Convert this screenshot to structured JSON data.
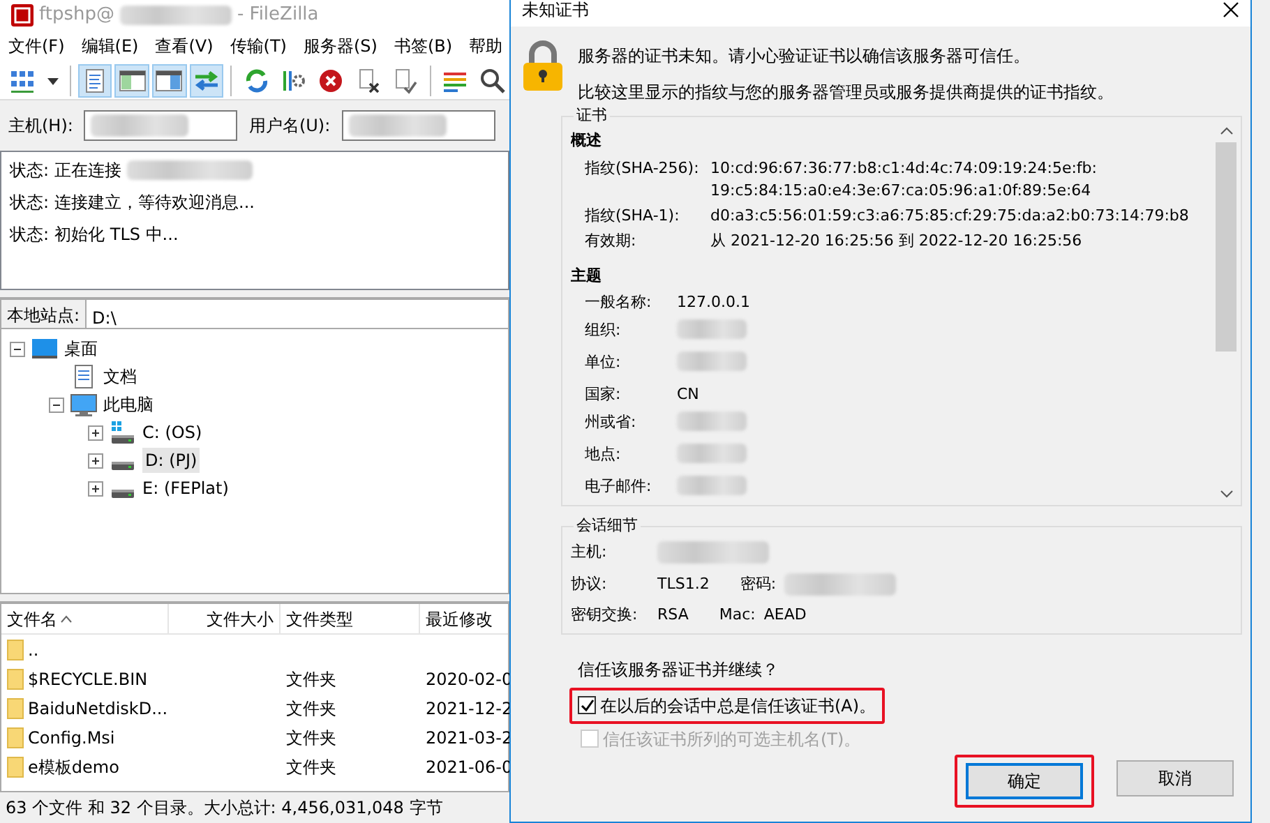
{
  "main_window": {
    "title_prefix": "ftpshp@",
    "title_redacted": true,
    "title_suffix": "- FileZilla",
    "menu": [
      "文件(F)",
      "编辑(E)",
      "查看(V)",
      "传输(T)",
      "服务器(S)",
      "书签(B)",
      "帮助"
    ],
    "toolbar": [
      {
        "kind": "sitemanager",
        "pressed": false
      },
      {
        "kind": "dropdown",
        "pressed": false
      },
      {
        "kind": "separator"
      },
      {
        "kind": "log",
        "pressed": true
      },
      {
        "kind": "localtree",
        "pressed": true
      },
      {
        "kind": "remotetree",
        "pressed": true
      },
      {
        "kind": "queue",
        "pressed": true
      },
      {
        "kind": "separator"
      },
      {
        "kind": "refresh",
        "pressed": false
      },
      {
        "kind": "process",
        "pressed": false
      },
      {
        "kind": "cancel",
        "pressed": false
      },
      {
        "kind": "disconnect",
        "pressed": false
      },
      {
        "kind": "reconnect",
        "pressed": false
      },
      {
        "kind": "separator"
      },
      {
        "kind": "filter",
        "pressed": false
      },
      {
        "kind": "search",
        "pressed": false
      }
    ],
    "quickconnect": [
      {
        "label": "主机(H):",
        "redacted": true
      },
      {
        "label": "用户名(U):",
        "redacted": true
      }
    ],
    "log": [
      {
        "label": "状态:",
        "text": "正在连接",
        "redacted": true
      },
      {
        "label": "状态:",
        "text": "连接建立，等待欢迎消息..."
      },
      {
        "label": "状态:",
        "text": "初始化 TLS 中..."
      }
    ],
    "local_site": {
      "label": "本地站点:",
      "path": "D:\\"
    },
    "tree": [
      {
        "label": "桌面",
        "kind": "desktop",
        "expanded": true,
        "selected": false,
        "children": [
          {
            "label": "文档",
            "kind": "document",
            "selected": false
          },
          {
            "label": "此电脑",
            "kind": "computer",
            "expanded": true,
            "selected": false,
            "children": [
              {
                "label": "C: (OS)",
                "kind": "systemdrive",
                "expanded": false,
                "selected": false
              },
              {
                "label": "D: (PJ)",
                "kind": "drive",
                "expanded": false,
                "selected": true
              },
              {
                "label": "E: (FEPlat)",
                "kind": "drive",
                "expanded": false,
                "selected": false
              }
            ]
          }
        ]
      }
    ],
    "file_list": {
      "columns": [
        {
          "label": "文件名",
          "sorted": true
        },
        {
          "label": "文件大小",
          "sorted": false
        },
        {
          "label": "文件类型",
          "sorted": false
        },
        {
          "label": "最近修改",
          "sorted": false
        }
      ],
      "rows": [
        {
          "name": ".."
        },
        {
          "name": "$RECYCLE.BIN",
          "type": "文件夹",
          "modified": "2020-02-0"
        },
        {
          "name": "BaiduNetdiskD...",
          "type": "文件夹",
          "modified": "2021-12-2"
        },
        {
          "name": "Config.Msi",
          "type": "文件夹",
          "modified": "2021-03-2"
        },
        {
          "name": "e模板demo",
          "type": "文件夹",
          "modified": "2021-06-0"
        }
      ]
    },
    "status_bar": "63 个文件 和 32 个目录。大小总计: 4,456,031,048 字节"
  },
  "dialog": {
    "title": "未知证书",
    "message": [
      "服务器的证书未知。请小心验证证书以确信该服务器可信任。",
      "比较这里显示的指纹与您的服务器管理员或服务提供商提供的证书指纹。"
    ],
    "certificate": {
      "legend": "证书",
      "sections": [
        {
          "heading": "概述",
          "rows": [
            {
              "label": "指纹(SHA-256):",
              "values": [
                "10:cd:96:67:36:77:b8:c1:4d:4c:74:09:19:24:5e:fb:",
                "19:c5:84:15:a0:e4:3e:67:ca:05:96:a1:0f:89:5e:64"
              ]
            },
            {
              "label": "指纹(SHA-1):",
              "values": [
                "d0:a3:c5:56:01:59:c3:a6:75:85:cf:29:75:da:a2:b0:73:14:79:b8"
              ]
            },
            {
              "label": "有效期:",
              "values": [
                "从 2021-12-20 16:25:56 到 2022-12-20 16:25:56"
              ]
            }
          ]
        },
        {
          "heading": "主题",
          "rows": [
            {
              "label": "一般名称:",
              "values": [
                "127.0.0.1"
              ]
            },
            {
              "label": "组织:",
              "redacted": true
            },
            {
              "label": "单位:",
              "redacted": true
            },
            {
              "label": "国家:",
              "values": [
                "CN"
              ]
            },
            {
              "label": "州或省:",
              "redacted": true
            },
            {
              "label": "地点:",
              "redacted": true
            },
            {
              "label": "电子邮件:",
              "redacted": true
            }
          ]
        }
      ]
    },
    "session": {
      "legend": "会话细节",
      "rows": [
        [
          {
            "label": "主机:",
            "redacted": true
          }
        ],
        [
          {
            "label": "协议:",
            "value": "TLS1.2"
          },
          {
            "label": "密码:",
            "redacted": true
          }
        ],
        [
          {
            "label": "密钥交换:",
            "value": "RSA"
          },
          {
            "label": "Mac:",
            "value": "AEAD"
          }
        ]
      ]
    },
    "question": "信任该服务器证书并继续？",
    "checkboxes": [
      {
        "label": "在以后的会话中总是信任该证书(A)。",
        "checked": true,
        "disabled": false,
        "highlighted": true
      },
      {
        "label": "信任该证书所列的可选主机名(T)。",
        "checked": false,
        "disabled": true
      }
    ],
    "buttons": [
      {
        "label": "确定",
        "default": true,
        "highlighted": true
      },
      {
        "label": "取消",
        "default": false
      }
    ]
  }
}
